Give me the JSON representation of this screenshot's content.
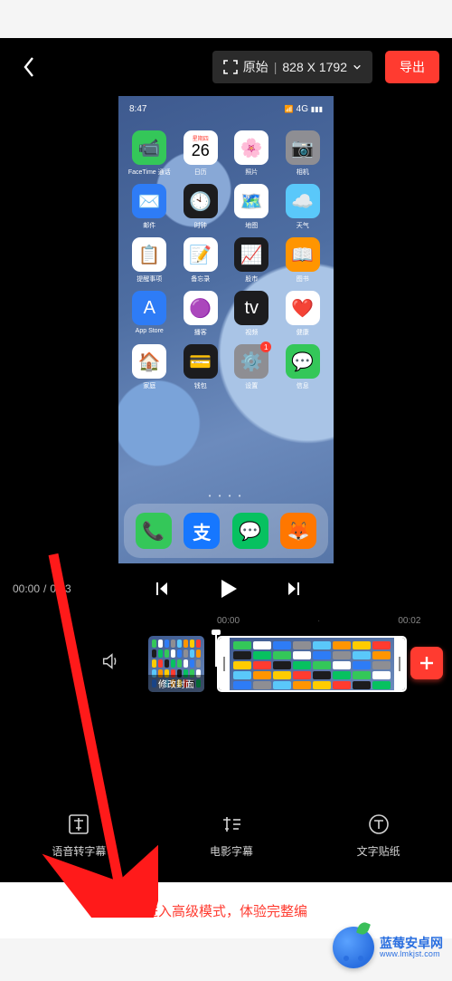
{
  "topbar": {
    "ratio_label": "原始",
    "dimensions": "828 X 1792",
    "export_label": "导出"
  },
  "phone": {
    "time": "8:47",
    "signal": "4G",
    "calendar_weekday": "星期四",
    "calendar_day": "26",
    "apps": [
      {
        "label": "FaceTime 通话",
        "color": "c-green",
        "glyph": "📹"
      },
      {
        "label": "日历",
        "color": "c-white",
        "glyph": ""
      },
      {
        "label": "照片",
        "color": "c-white",
        "glyph": "🌸"
      },
      {
        "label": "相机",
        "color": "c-gray",
        "glyph": "📷"
      },
      {
        "label": "邮件",
        "color": "c-blue",
        "glyph": "✉️"
      },
      {
        "label": "时钟",
        "color": "c-dgray",
        "glyph": "🕙"
      },
      {
        "label": "地图",
        "color": "c-white",
        "glyph": "🗺️"
      },
      {
        "label": "天气",
        "color": "c-lblue",
        "glyph": "☁️"
      },
      {
        "label": "提醒事项",
        "color": "c-white",
        "glyph": "📋"
      },
      {
        "label": "备忘录",
        "color": "c-white",
        "glyph": "📝"
      },
      {
        "label": "股市",
        "color": "c-dgray",
        "glyph": "📈"
      },
      {
        "label": "图书",
        "color": "c-book",
        "glyph": "📖"
      },
      {
        "label": "App Store",
        "color": "c-blue",
        "glyph": "A"
      },
      {
        "label": "播客",
        "color": "c-white",
        "glyph": "🟣"
      },
      {
        "label": "视频",
        "color": "c-dgray",
        "glyph": "tv"
      },
      {
        "label": "健康",
        "color": "c-white",
        "glyph": "❤️"
      },
      {
        "label": "家庭",
        "color": "c-white",
        "glyph": "🏠"
      },
      {
        "label": "钱包",
        "color": "c-dgray",
        "glyph": "💳"
      },
      {
        "label": "设置",
        "color": "c-gray",
        "glyph": "⚙️",
        "badge": "1"
      },
      {
        "label": "信息",
        "color": "c-green",
        "glyph": "💬"
      }
    ],
    "dock": [
      {
        "name": "phone",
        "color": "c-green",
        "glyph": "📞"
      },
      {
        "name": "alipay",
        "color": "c-alip",
        "glyph": "支"
      },
      {
        "name": "wechat",
        "color": "c-wechat",
        "glyph": "💬"
      },
      {
        "name": "uc",
        "color": "c-uc",
        "glyph": "🦊"
      }
    ]
  },
  "playback": {
    "current": "00:00",
    "total": "00:3",
    "ticks": [
      "00:00",
      "00:02"
    ]
  },
  "timeline": {
    "cover_label": "修改封面"
  },
  "tools": [
    {
      "id": "speech-to-subtitle",
      "label": "语音转字幕"
    },
    {
      "id": "movie-subtitle",
      "label": "电影字幕"
    },
    {
      "id": "text-sticker",
      "label": "文字贴纸"
    }
  ],
  "advanced": {
    "text": "进入高级模式，体验完整编"
  },
  "watermark": {
    "name_cn": "蓝莓安卓网",
    "url": "www.lmkjst.com"
  }
}
